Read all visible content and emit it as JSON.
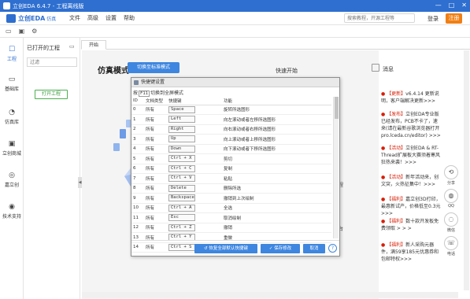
{
  "window": {
    "title": "立创EDA 6.4.7 - 工程离线版",
    "controls": [
      "—",
      "□",
      "✕"
    ]
  },
  "brand": {
    "name": "立创EDA",
    "sub": "仿真"
  },
  "menu": [
    "文件",
    "高级",
    "设置",
    "帮助"
  ],
  "header": {
    "search_placeholder": "搜索教程，开源工程等",
    "login": "登录",
    "register": "注册"
  },
  "toolbar_icons": [
    "folder-icon",
    "save-icon",
    "settings-icon"
  ],
  "sidebar": [
    {
      "label": "工程",
      "icon": "☐",
      "name": "sidebar-item-project"
    },
    {
      "label": "基础库",
      "icon": "▭",
      "name": "sidebar-item-basic-library"
    },
    {
      "label": "仿真库",
      "icon": "◔",
      "name": "sidebar-item-simulation-library"
    },
    {
      "label": "立创商城",
      "icon": "▣",
      "name": "sidebar-item-lcsc-mall"
    },
    {
      "label": "嘉立创",
      "icon": "◎",
      "name": "sidebar-item-jlc"
    },
    {
      "label": "技术支持",
      "icon": "◉",
      "name": "sidebar-item-tech-support"
    }
  ],
  "project_panel": {
    "title": "已打开的工程",
    "filter_placeholder": "过滤",
    "open_button": "打开工程"
  },
  "tabs": {
    "start": "开始"
  },
  "content": {
    "sim_title": "仿真模式",
    "switch_button": "切换至标准模式",
    "quick_start": "快速开始",
    "text_a": "程",
    "text_b": "台"
  },
  "dialog": {
    "title": "快捷键设置",
    "hint_prefix": "按",
    "hint_key": "F11",
    "hint_suffix": "切换到全屏模式",
    "columns": [
      "ID",
      "文档类型",
      "快捷键",
      "功能"
    ],
    "rows": [
      [
        "0",
        "所有",
        "Space",
        "旋转所选图形"
      ],
      [
        "1",
        "所有",
        "Left",
        "向左滚动或者左移所选图形"
      ],
      [
        "2",
        "所有",
        "Right",
        "向右滚动或者右移所选图形"
      ],
      [
        "3",
        "所有",
        "Up",
        "向上滚动或者上移所选图形"
      ],
      [
        "4",
        "所有",
        "Down",
        "向下滚动或者下移所选图形"
      ],
      [
        "5",
        "所有",
        "Ctrl + X",
        "剪切"
      ],
      [
        "6",
        "所有",
        "Ctrl + C",
        "复制"
      ],
      [
        "7",
        "所有",
        "Ctrl + V",
        "粘贴"
      ],
      [
        "8",
        "所有",
        "Delete",
        "删除所选"
      ],
      [
        "9",
        "所有",
        "Backspace",
        "撤销到上次绘制"
      ],
      [
        "10",
        "所有",
        "Ctrl + A",
        "全选"
      ],
      [
        "11",
        "所有",
        "Esc",
        "取消绘制"
      ],
      [
        "12",
        "所有",
        "Ctrl + Z",
        "撤销"
      ],
      [
        "13",
        "所有",
        "Ctrl + Y",
        "重做"
      ],
      [
        "14",
        "所有",
        "Ctrl + S",
        "保存"
      ]
    ],
    "buttons": {
      "restore": "恢复全部默认快捷键",
      "save": "保存修改",
      "cancel": "取消",
      "help": "?"
    }
  },
  "news": {
    "title": "消息",
    "items": [
      {
        "tag": "【更新】",
        "text": "v6.4.14 更新说明，客户端解决更新>>>"
      },
      {
        "tag": "【发布】",
        "text": "立创EDA专业版已经发布，PCB不卡了，速来(请在最新谷歌浏览器打开pro.lceda.cn/editor) >>>"
      },
      {
        "tag": "【活动】",
        "text": "立创EDA & RT-Thread扩展板大赛须着寒风狂热来袭！>>>"
      },
      {
        "tag": "【活动】",
        "text": "新年活动来，创文突，火热征集中！>>>"
      },
      {
        "tag": "【福利】",
        "text": "嘉立创3D打印，最惠新试产，价格低至0.3元>>>"
      },
      {
        "tag": "【福利】",
        "text": "数十款开发板免费领取 > > >"
      },
      {
        "tag": "【福利】",
        "text": "新人采购元器件，满59享185元优惠券和包邮特权>>>"
      }
    ]
  },
  "share": [
    {
      "label": "分享",
      "icon": "⟲"
    },
    {
      "label": "QQ",
      "icon": "◍"
    },
    {
      "label": "微信",
      "icon": "◌"
    },
    {
      "label": "电话",
      "icon": "☏"
    }
  ],
  "colors": {
    "brand_blue": "#2e6fd0",
    "register_orange": "#f07f14",
    "news_red": "#d81e06",
    "button_blue": "#3e86df"
  }
}
